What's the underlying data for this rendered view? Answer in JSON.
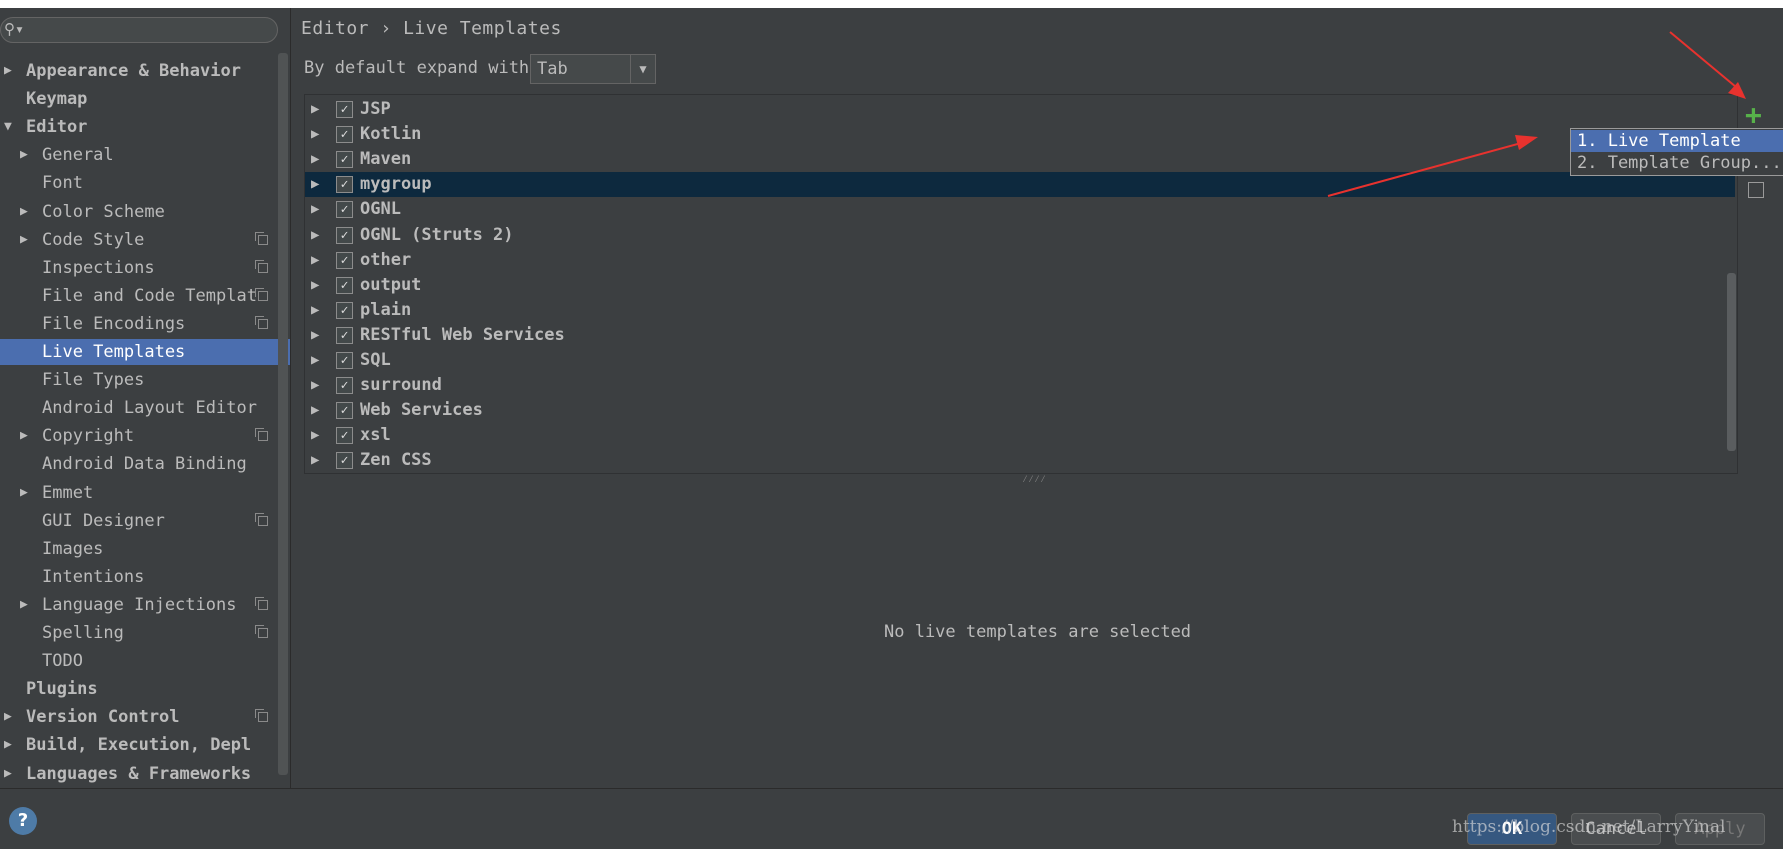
{
  "sidebar": {
    "search": {
      "placeholder": "",
      "value": ""
    },
    "items": [
      {
        "label": "Appearance & Behavior",
        "depth": 0,
        "arrow": "▶",
        "bold": true,
        "copy": false,
        "selected": false
      },
      {
        "label": "Keymap",
        "depth": 0,
        "arrow": "",
        "bold": true,
        "copy": false,
        "selected": false
      },
      {
        "label": "Editor",
        "depth": 0,
        "arrow": "▼",
        "bold": true,
        "copy": false,
        "selected": false
      },
      {
        "label": "General",
        "depth": 1,
        "arrow": "▶",
        "bold": false,
        "copy": false,
        "selected": false
      },
      {
        "label": "Font",
        "depth": 1,
        "arrow": "",
        "bold": false,
        "copy": false,
        "selected": false
      },
      {
        "label": "Color Scheme",
        "depth": 1,
        "arrow": "▶",
        "bold": false,
        "copy": false,
        "selected": false
      },
      {
        "label": "Code Style",
        "depth": 1,
        "arrow": "▶",
        "bold": false,
        "copy": true,
        "selected": false
      },
      {
        "label": "Inspections",
        "depth": 1,
        "arrow": "",
        "bold": false,
        "copy": true,
        "selected": false
      },
      {
        "label": "File and Code Templat",
        "depth": 1,
        "arrow": "",
        "bold": false,
        "copy": true,
        "selected": false
      },
      {
        "label": "File Encodings",
        "depth": 1,
        "arrow": "",
        "bold": false,
        "copy": true,
        "selected": false
      },
      {
        "label": "Live Templates",
        "depth": 1,
        "arrow": "",
        "bold": false,
        "copy": false,
        "selected": true
      },
      {
        "label": "File Types",
        "depth": 1,
        "arrow": "",
        "bold": false,
        "copy": false,
        "selected": false
      },
      {
        "label": "Android Layout Editor",
        "depth": 1,
        "arrow": "",
        "bold": false,
        "copy": false,
        "selected": false
      },
      {
        "label": "Copyright",
        "depth": 1,
        "arrow": "▶",
        "bold": false,
        "copy": true,
        "selected": false
      },
      {
        "label": "Android Data Binding",
        "depth": 1,
        "arrow": "",
        "bold": false,
        "copy": false,
        "selected": false
      },
      {
        "label": "Emmet",
        "depth": 1,
        "arrow": "▶",
        "bold": false,
        "copy": false,
        "selected": false
      },
      {
        "label": "GUI Designer",
        "depth": 1,
        "arrow": "",
        "bold": false,
        "copy": true,
        "selected": false
      },
      {
        "label": "Images",
        "depth": 1,
        "arrow": "",
        "bold": false,
        "copy": false,
        "selected": false
      },
      {
        "label": "Intentions",
        "depth": 1,
        "arrow": "",
        "bold": false,
        "copy": false,
        "selected": false
      },
      {
        "label": "Language Injections",
        "depth": 1,
        "arrow": "▶",
        "bold": false,
        "copy": true,
        "selected": false
      },
      {
        "label": "Spelling",
        "depth": 1,
        "arrow": "",
        "bold": false,
        "copy": true,
        "selected": false
      },
      {
        "label": "TODO",
        "depth": 1,
        "arrow": "",
        "bold": false,
        "copy": false,
        "selected": false
      },
      {
        "label": "Plugins",
        "depth": 0,
        "arrow": "",
        "bold": true,
        "copy": false,
        "selected": false
      },
      {
        "label": "Version Control",
        "depth": 0,
        "arrow": "▶",
        "bold": true,
        "copy": true,
        "selected": false
      },
      {
        "label": "Build, Execution, Depl",
        "depth": 0,
        "arrow": "▶",
        "bold": true,
        "copy": false,
        "selected": false
      },
      {
        "label": "Languages & Frameworks",
        "depth": 0,
        "arrow": "▶",
        "bold": true,
        "copy": false,
        "selected": false
      }
    ]
  },
  "breadcrumb": {
    "parent": "Editor",
    "separator": "›",
    "current": "Live Templates"
  },
  "expand": {
    "label": "By default expand with",
    "value": "Tab",
    "arrow": "▼"
  },
  "groups": [
    {
      "label": "JSP",
      "checked": true,
      "selected": false
    },
    {
      "label": "Kotlin",
      "checked": true,
      "selected": false
    },
    {
      "label": "Maven",
      "checked": true,
      "selected": false
    },
    {
      "label": "mygroup",
      "checked": true,
      "selected": true
    },
    {
      "label": "OGNL",
      "checked": true,
      "selected": false
    },
    {
      "label": "OGNL (Struts 2)",
      "checked": true,
      "selected": false
    },
    {
      "label": "other",
      "checked": true,
      "selected": false
    },
    {
      "label": "output",
      "checked": true,
      "selected": false
    },
    {
      "label": "plain",
      "checked": true,
      "selected": false
    },
    {
      "label": "RESTful Web Services",
      "checked": true,
      "selected": false
    },
    {
      "label": "SQL",
      "checked": true,
      "selected": false
    },
    {
      "label": "surround",
      "checked": true,
      "selected": false
    },
    {
      "label": "Web Services",
      "checked": true,
      "selected": false
    },
    {
      "label": "xsl",
      "checked": true,
      "selected": false
    },
    {
      "label": "Zen CSS",
      "checked": true,
      "selected": false
    }
  ],
  "toolbar": {
    "add_icon": "+"
  },
  "popup": {
    "items": [
      {
        "label": "1. Live Template",
        "selected": true
      },
      {
        "label": "2. Template Group...",
        "selected": false
      }
    ]
  },
  "detail": {
    "empty_message": "No live templates are selected",
    "splitter": "⁄⁄⁄⁄"
  },
  "footer": {
    "help": "?",
    "ok": "OK",
    "cancel": "Cancel",
    "apply": "Apply",
    "watermark": "https://blog.csdn.net/LarryYinal"
  },
  "colors": {
    "accent": "#4b6eaf",
    "selection_dark": "#0d293e",
    "add_green": "#57b14a",
    "arrow_red": "#e8322e"
  }
}
